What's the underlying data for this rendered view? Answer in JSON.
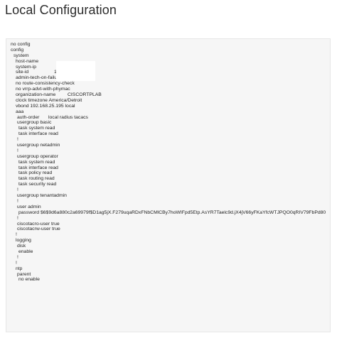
{
  "page": {
    "title": "Local Configuration"
  },
  "config_lines": [
    {
      "text": "no config"
    },
    {
      "text": "config"
    },
    {
      "text": "system"
    },
    {
      "text": "host-name"
    },
    {
      "text": "system-ip"
    },
    {
      "text": "site-id",
      "value": "1"
    },
    {
      "text": "admin-tech-on-failure"
    },
    {
      "text": "no route-consistency-check"
    },
    {
      "text": "no vrrp-advt-with-phymac"
    },
    {
      "text": "organization-name",
      "value": "CISCORTPLAB"
    },
    {
      "text": "clock timezone America/Detroit"
    },
    {
      "text": "vbond 192.168.25.195 local"
    },
    {
      "text": "aaa"
    },
    {
      "text": "auth-order",
      "value": "local radius tacacs"
    },
    {
      "text": "usergroup basic"
    },
    {
      "text": "task system read"
    },
    {
      "text": "task interface read"
    },
    {
      "text": "!"
    },
    {
      "text": "usergroup netadmin"
    },
    {
      "text": "!"
    },
    {
      "text": "usergroup operator"
    },
    {
      "text": "task system read"
    },
    {
      "text": "task interface read"
    },
    {
      "text": "task policy read"
    },
    {
      "text": "task routing read"
    },
    {
      "text": "task security read"
    },
    {
      "text": "!"
    },
    {
      "text": "usergroup tenantadmin"
    },
    {
      "text": "!"
    },
    {
      "text": "user admin"
    },
    {
      "text": "password $6$9d6a880c2a69979f$D1ag5jX.F279uqaRDxFNbCMlCBy7hoWIFpd5Etp.AsYR7Taelc9d.jX4jV66yFKaYfcWTJPQO0qRIV79FbPd80"
    },
    {
      "text": "!"
    },
    {
      "text": "ciscotacro-user true"
    },
    {
      "text": "ciscotacrw-user true"
    },
    {
      "text": "!"
    },
    {
      "text": "logging"
    },
    {
      "text": "disk"
    },
    {
      "text": "enable"
    },
    {
      "text": "!"
    },
    {
      "text": "!"
    },
    {
      "text": "ntp"
    },
    {
      "text": "parent"
    },
    {
      "text": "no enable"
    }
  ]
}
